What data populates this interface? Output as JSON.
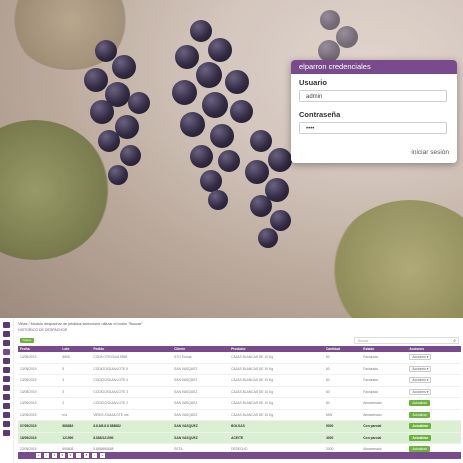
{
  "login": {
    "title": "elparron credenciales",
    "user_label": "Usuario",
    "user_value": "admin",
    "password_label": "Contraseña",
    "password_value": "••••",
    "submit_label": "iniciar sesión"
  },
  "app": {
    "breadcrumb": "Viñas / Modulo despachar de pedidos seleccione utilizar el botón \"Buscar\"",
    "subtitle": "HISTORICO DE DESPACHOS",
    "new_button": "Nuevo",
    "search_placeholder": "Buscar...",
    "columns": [
      "Fecha",
      "Lote",
      "Pedido",
      "Cliente",
      "Producto",
      "Cantidad",
      "Estado",
      "Acciones"
    ],
    "rows": [
      {
        "c": [
          "13/05/2019",
          "5555",
          "COD/LOTE/GUIA 5555",
          "STO Tomas",
          "CAJAS BLANCAS DE 10 Kg",
          "60",
          "Facturado",
          "Acciones ▾"
        ],
        "hl": false,
        "green": false
      },
      {
        "c": [
          "13/05/2019",
          "5",
          "CODIGO/GUIA/LOTE 5",
          "SAN VASQUEZ",
          "CAJAS BLANCAS DE 10 Kg",
          "60",
          "Facturado",
          "Acciones ▾"
        ],
        "hl": false,
        "green": false
      },
      {
        "c": [
          "13/05/2019",
          "4",
          "CODIGO/GUIA/LOTE 4",
          "SAN VASQUEZ",
          "CAJAS BLANCAS DE 10 Kg",
          "60",
          "Facturado",
          "Acciones ▾"
        ],
        "hl": false,
        "green": false
      },
      {
        "c": [
          "13/05/2019",
          "3",
          "CODIGO/GUIA/LOTE 3",
          "SAN VASQUEZ",
          "CAJAS BLANCAS DE 10 Kg",
          "60",
          "Facturado",
          "Acciones ▾"
        ],
        "hl": false,
        "green": false
      },
      {
        "c": [
          "13/05/2019",
          "2",
          "CODIGO/GUIA/LOTE 2",
          "SAN VASQUEZ",
          "CAJAS BLANCAS DE 10 Kg",
          "60",
          "Almacenado",
          "Actualizar"
        ],
        "hl": false,
        "green": true
      },
      {
        "c": [
          "13/05/2019",
          "n/a",
          "VIÑOS /GUIA/LOTE n/a",
          "SAN VASQUEZ",
          "CAJAS BLANCAS DE 10 Kg",
          "MIN",
          "Almacenado",
          "Actualizar"
        ],
        "hl": false,
        "green": true
      },
      {
        "c": [
          "07/05/2019",
          "888882",
          "8.8.8/8.8.8 888882",
          "SAN VASQUEZ",
          "BOLSAS",
          "5000",
          "Con parcial",
          "Actualizar"
        ],
        "hl": true,
        "green": true
      },
      {
        "c": [
          "18/05/2019",
          "121590",
          "8.888/121590",
          "SAN VASQUEZ",
          "ACEITE",
          "4000",
          "Con parcial",
          "Actualizar"
        ],
        "hl": true,
        "green": true
      },
      {
        "c": [
          "22/05/2019",
          "655808",
          "8.888/655808",
          "SETA",
          "DESECHO",
          "2000",
          "Almacenado",
          "Actualizar"
        ],
        "hl": false,
        "green": true
      }
    ],
    "pager": [
      "«",
      "‹",
      "1",
      "2",
      "3",
      "...",
      "8",
      "›",
      "»"
    ]
  }
}
